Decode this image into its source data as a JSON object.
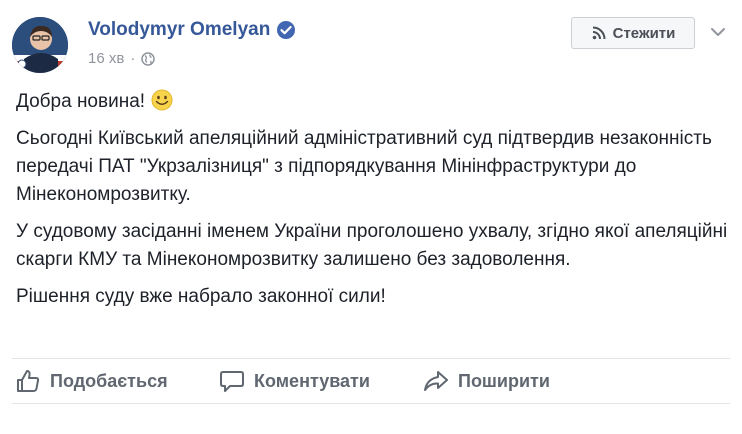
{
  "author": {
    "name": "Volodymyr Omelyan"
  },
  "meta": {
    "time": "16 хв",
    "separator": "·"
  },
  "follow": {
    "label": "Стежити"
  },
  "post": {
    "paragraphs": [
      "Добра новина!",
      "Сьогодні Київський апеляційний адміністративний суд підтвердив незаконність передачі ПАТ \"Укрзалізниця\" з підпорядкування Мінінфраструктури до Мінекономрозвитку.",
      "У судовому засіданні іменем України проголошено ухвалу, згідно якої апеляційні скарги КМУ та Мінекономрозвитку залишено без задоволення.",
      "Рішення суду вже набрало законної сили!"
    ]
  },
  "actions": {
    "like": "Подобається",
    "comment": "Коментувати",
    "share": "Поширити"
  },
  "icons": {
    "verified": "verified-badge-icon",
    "globe": "globe-icon",
    "rss": "rss-icon",
    "more": "chevron-down-icon",
    "emoji": "smile-emoji-icon",
    "like": "thumbs-up-icon",
    "comment": "comment-bubble-icon",
    "share": "share-arrow-icon"
  },
  "colors": {
    "author": "#365899",
    "verified": "#4267b2",
    "meta": "#90949c",
    "text": "#1d2129",
    "action": "#606770",
    "button_bg": "#f6f7f9"
  }
}
